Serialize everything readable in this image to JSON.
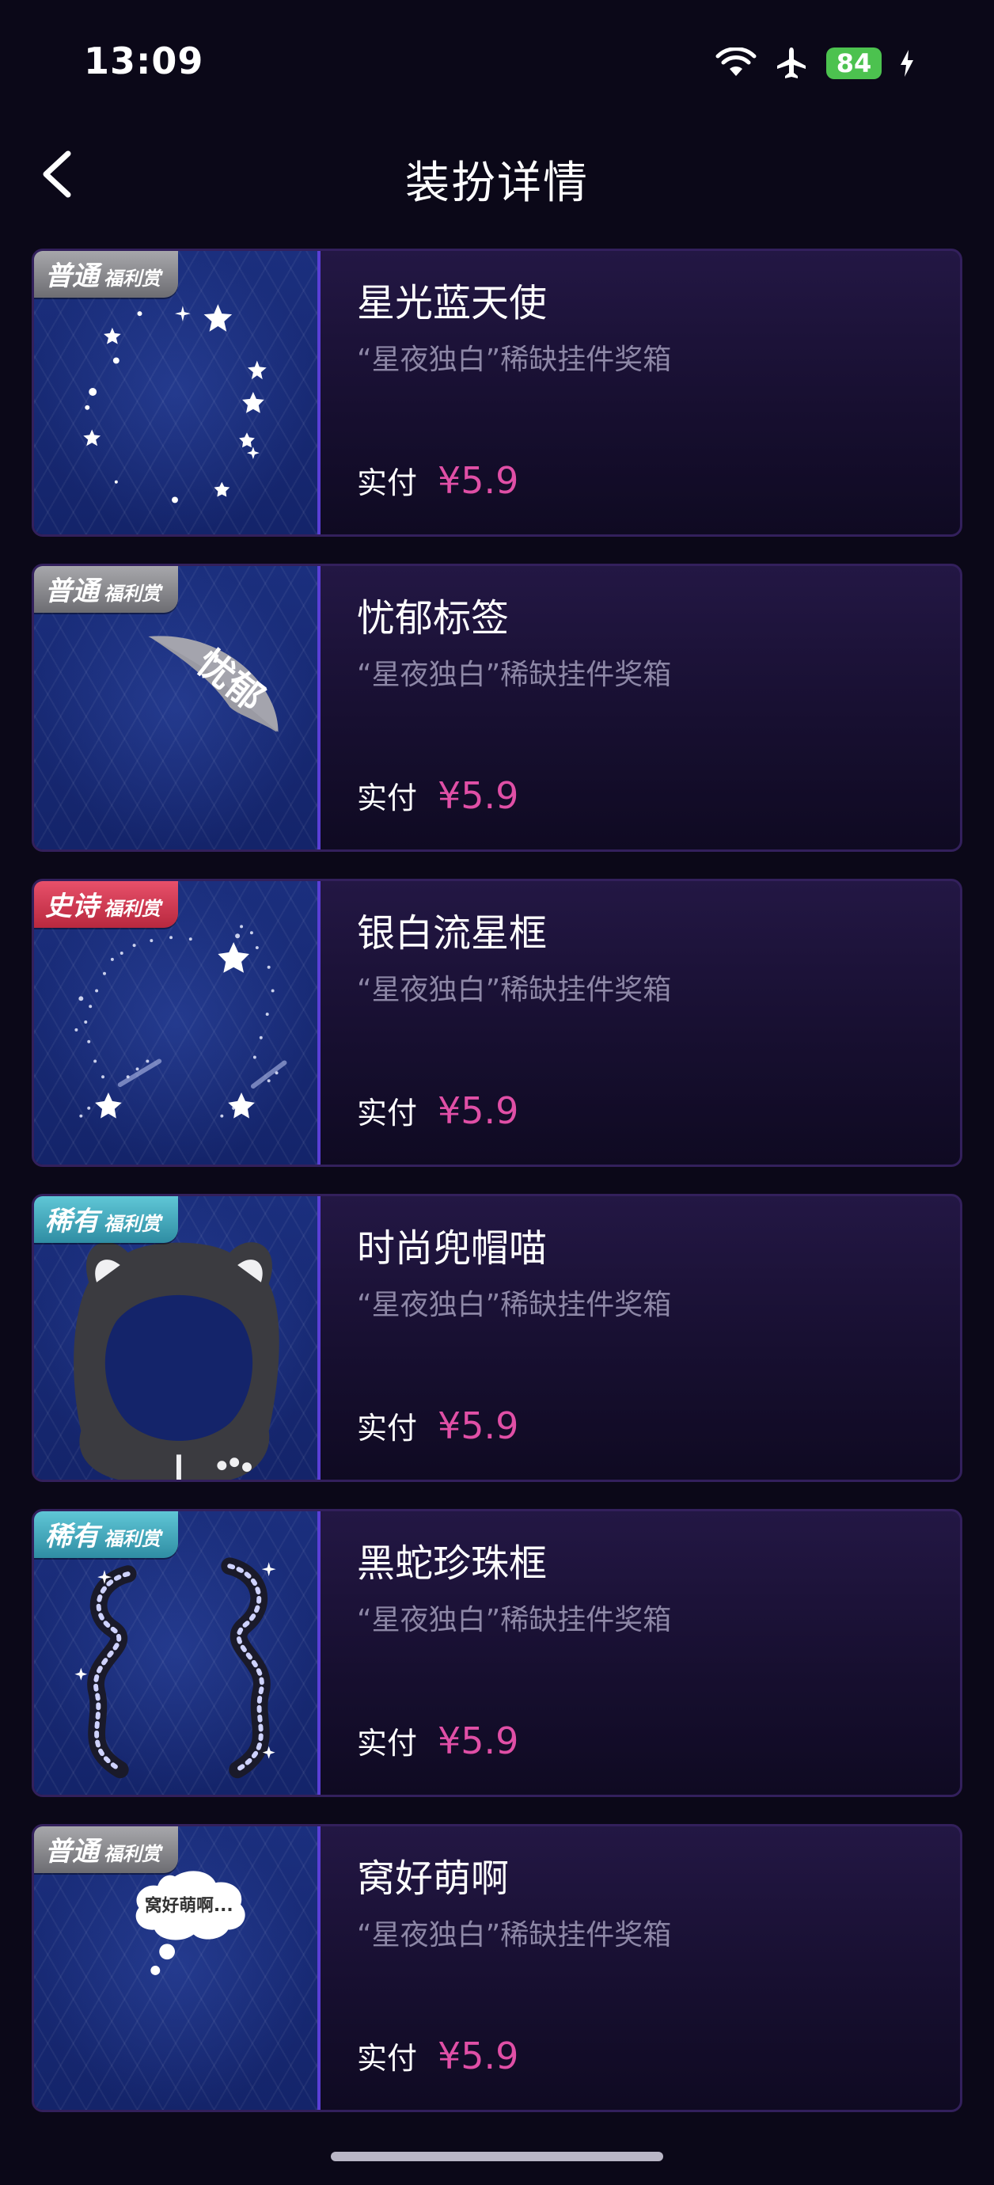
{
  "status_bar": {
    "time": "13:09",
    "battery": "84"
  },
  "header": {
    "title": "装扮详情"
  },
  "items": [
    {
      "tag": "普通",
      "tag_sub": "福利赏",
      "tag_type": "putong",
      "name": "星光蓝天使",
      "source": "“星夜独白”稀缺挂件奖箱",
      "price_label": "实付",
      "price": "¥5.9"
    },
    {
      "tag": "普通",
      "tag_sub": "福利赏",
      "tag_type": "putong",
      "name": "忧郁标签",
      "source": "“星夜独白”稀缺挂件奖箱",
      "price_label": "实付",
      "price": "¥5.9",
      "art_text": "忧郁"
    },
    {
      "tag": "史诗",
      "tag_sub": "福利赏",
      "tag_type": "shishi",
      "name": "银白流星框",
      "source": "“星夜独白”稀缺挂件奖箱",
      "price_label": "实付",
      "price": "¥5.9"
    },
    {
      "tag": "稀有",
      "tag_sub": "福利赏",
      "tag_type": "xiyou",
      "name": "时尚兜帽喵",
      "source": "“星夜独白”稀缺挂件奖箱",
      "price_label": "实付",
      "price": "¥5.9"
    },
    {
      "tag": "稀有",
      "tag_sub": "福利赏",
      "tag_type": "xiyou",
      "name": "黑蛇珍珠框",
      "source": "“星夜独白”稀缺挂件奖箱",
      "price_label": "实付",
      "price": "¥5.9"
    },
    {
      "tag": "普通",
      "tag_sub": "福利赏",
      "tag_type": "putong",
      "name": "窝好萌啊",
      "source": "“星夜独白”稀缺挂件奖箱",
      "price_label": "实付",
      "price": "¥5.9",
      "art_text": "窝好萌啊..."
    }
  ],
  "colors": {
    "price": "#e04fa6",
    "accent_border": "#5a3fd6",
    "background": "#0b0818"
  }
}
